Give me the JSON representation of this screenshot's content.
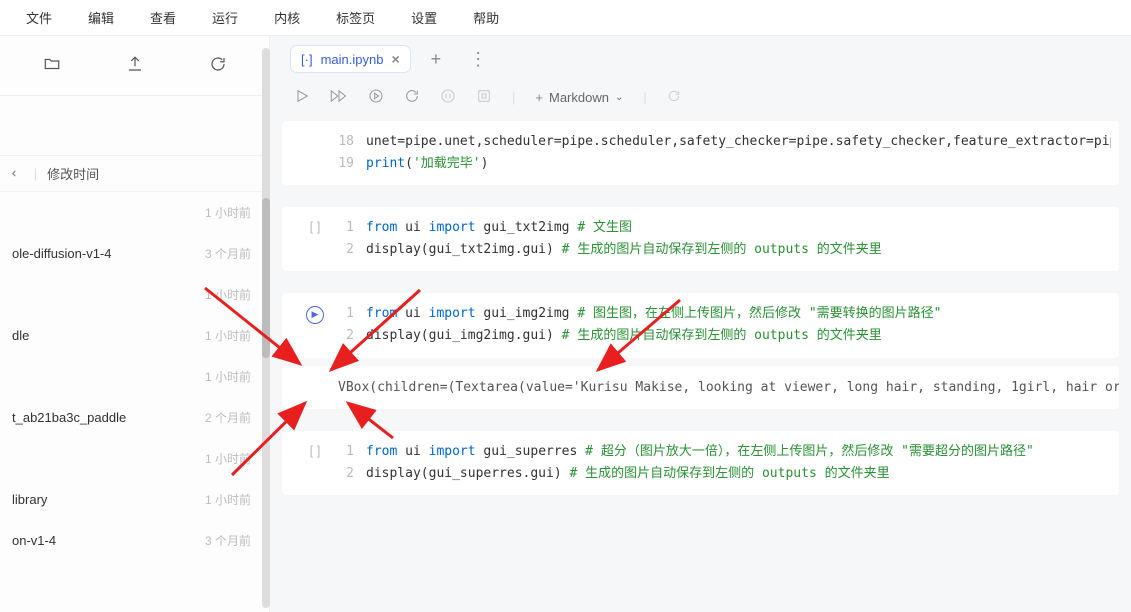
{
  "menu": [
    "文件",
    "编辑",
    "查看",
    "运行",
    "内核",
    "标签页",
    "设置",
    "帮助"
  ],
  "sidebar": {
    "header_label": "修改时间",
    "files": [
      {
        "name": "",
        "time": "1 小时前"
      },
      {
        "name": "ole-diffusion-v1-4",
        "time": "3 个月前"
      },
      {
        "name": "",
        "time": "1 小时前"
      },
      {
        "name": "dle",
        "time": "1 小时前"
      },
      {
        "name": "",
        "time": "1 小时前"
      },
      {
        "name": "t_ab21ba3c_paddle",
        "time": "2 个月前"
      },
      {
        "name": "",
        "time": "1 小时前"
      },
      {
        "name": "library",
        "time": "1 小时前"
      },
      {
        "name": "on-v1-4",
        "time": "3 个月前"
      }
    ]
  },
  "tab": {
    "icon": "notebook",
    "name": "main.ipynb"
  },
  "toolbar": {
    "add_label": "Markdown"
  },
  "cells": {
    "c0": {
      "ln18": "18",
      "ln19": "19",
      "l18": "unet=pipe.unet,scheduler=pipe.scheduler,safety_checker=pipe.safety_checker,feature_extractor=pipe.feature_ex",
      "l19a": "print",
      "l19b": "(",
      "l19c": "'加载完毕'",
      "l19d": ")"
    },
    "c1": {
      "prompt": "[ ]",
      "l1": {
        "from": "from",
        "ui": " ui ",
        "import": "import",
        "fn": " gui_txt2img ",
        "cmt": "# 文生图"
      },
      "l2": {
        "a": "display(gui_txt2img.gui) ",
        "cmt": "# 生成的图片自动保存到左侧的 ",
        "out": "outputs",
        "cmt2": " 的文件夹里"
      }
    },
    "c2": {
      "l1": {
        "from": "from",
        "ui": " ui ",
        "import": "import",
        "fn": " gui_img2img ",
        "cmt": "# 图生图，在左侧上传图片，然后修改 \"需要转换的图片路径\""
      },
      "l2": {
        "a": "display(gui_img2img.gui) ",
        "cmt": "# 生成的图片自动保存到左侧的 ",
        "out": "outputs",
        "cmt2": " 的文件夹里"
      }
    },
    "out2": "VBox(children=(Textarea(value='Kurisu Makise, looking at viewer, long hair, standing, 1girl, hair ornament, h",
    "c3": {
      "prompt": "[ ]",
      "l1": {
        "from": "from",
        "ui": " ui ",
        "import": "import",
        "fn": " gui_superres ",
        "cmt": "# 超分（图片放大一倍），在左侧上传图片，然后修改 \"需要超分的图片路径\""
      },
      "l2": {
        "a": "display(gui_superres.gui) ",
        "cmt": "# 生成的图片自动保存到左侧的 ",
        "out": "outputs",
        "cmt2": " 的文件夹里"
      }
    }
  }
}
